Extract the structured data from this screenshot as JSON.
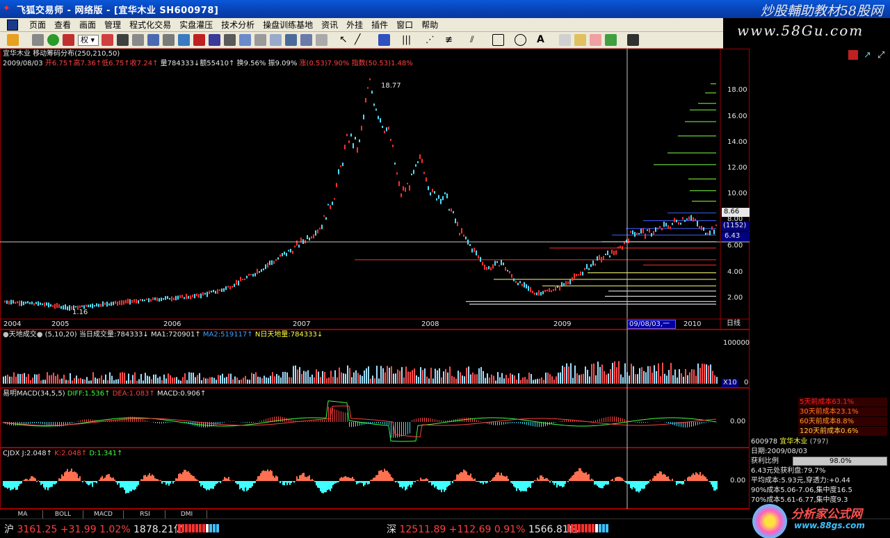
{
  "window": {
    "title": "飞狐交易师 - 网络版 - [宜华木业 SH600978]",
    "promo_top": "炒股輔助教材58股网",
    "promo_url": "www.58Gu.com"
  },
  "menu": [
    "页面",
    "查看",
    "画面",
    "管理",
    "程式化交易",
    "实盘灌压",
    "技术分析",
    "操盘训练基地",
    "资讯",
    "外挂",
    "插件",
    "窗口",
    "帮助"
  ],
  "toolbar": {
    "weight_label": "权"
  },
  "main_chart": {
    "stock_name": "宜华木业",
    "indicator": "移动筹码分布",
    "params": "(250,210,50)",
    "info_date": "2009/08/03",
    "open": "开6.75",
    "high": "高7.36",
    "low": "低6.75",
    "close": "收7.24",
    "volume": "量784333",
    "amount": "额55410",
    "turnover": "换9.56%",
    "amplitude": "振9.09%",
    "change": "涨(0.53)7.90%",
    "index_change": "指数(50.53)1.48%",
    "peak_label": "18.77",
    "low_label": "1.16",
    "y_ticks": [
      "18.00",
      "16.00",
      "14.00",
      "12.00",
      "10.00",
      "8.00",
      "6.00",
      "4.00",
      "2.00"
    ],
    "price_tag_high": "8.66",
    "price_tag_count": "(1152)",
    "price_tag_cur": "6.43",
    "x_labels": [
      "2004",
      "2005",
      "2006",
      "2007",
      "2008",
      "2009",
      "2010"
    ],
    "cursor_date": "09/08/03,一",
    "period": "日线"
  },
  "volume_panel": {
    "title": "天地成交",
    "params": "(5,10,20)",
    "today_vol": "当日成交量:784333",
    "ma1": "MA1:720901",
    "ma2": "MA2:519117",
    "nday": "N日天地量:784333",
    "y_top": "100000",
    "y_bottom": "0",
    "unit": "X10"
  },
  "macd_panel": {
    "title": "易明MACD",
    "params": "(34,5,5)",
    "diff": "DIFF:1.536",
    "dea": "DEA:1.083",
    "macd": "MACD:0.906",
    "y_zero": "0.00"
  },
  "cjdx_panel": {
    "title": "CJDX",
    "j": "J:2.048",
    "k": "K:2.048",
    "d": "D:1.341",
    "y_zero": "0.00"
  },
  "right_panel": {
    "cost_rows": [
      {
        "label": "5天前成本63.1%",
        "color": "#ff2020"
      },
      {
        "label": "30天前成本23.1%",
        "color": "#ff7a1a"
      },
      {
        "label": "60天前成本8.8%",
        "color": "#ff9a2a"
      },
      {
        "label": "120天前成本0.6%",
        "color": "#ffd040"
      }
    ],
    "stock_code": "600978",
    "stock_name": "宜华木业",
    "stock_extra": "(797)",
    "date_label": "日期:2009/08/03",
    "profit_label": "获利比例",
    "profit_value": "98.0%",
    "profit_line": "6.43元处获利盘:79.7%",
    "avg_cost": "平均成本:5.93元,穿透力:+0.44",
    "cost90": "90%成本5.06-7.06,集中度16.5",
    "cost70": "70%成本5.61-6.77,集中度9.3"
  },
  "tabs": [
    "MA",
    "BOLL",
    "MACD",
    "RSI",
    "DMI"
  ],
  "status": {
    "sh_label": "沪",
    "sh_value": "3161.25",
    "sh_change": "+31.99",
    "sh_pct": "1.02%",
    "sh_amount": "1878.21亿",
    "sz_label": "深",
    "sz_value": "12511.89",
    "sz_change": "+112.69",
    "sz_pct": "0.91%",
    "sz_amount": "1566.81亿",
    "logo_text": "分析家公式网",
    "logo_url": "www.88gs.com"
  }
}
